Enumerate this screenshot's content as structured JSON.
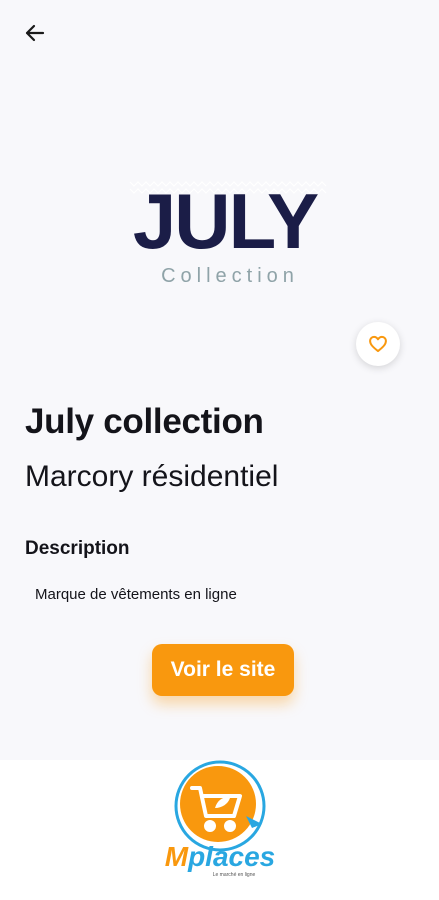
{
  "header": {
    "back_icon": "arrow-left-icon"
  },
  "brand": {
    "logo_main": "JULY",
    "logo_sub": "Collection",
    "logo_color": "#1b1d47"
  },
  "favorite": {
    "icon": "heart-outline-icon",
    "color": "#f9980e"
  },
  "store": {
    "name": "July collection",
    "location": "Marcory résidentiel",
    "description_heading": "Description",
    "description": "Marque de vêtements en ligne"
  },
  "actions": {
    "visit_site_label": "Voir le site",
    "accent_color": "#f9980e"
  },
  "footer_logo": {
    "name": "Mplaces",
    "tagline": "Le marché en ligne",
    "primary_color": "#f9980e",
    "secondary_color": "#29a7e1",
    "icon": "shopping-cart-icon"
  }
}
